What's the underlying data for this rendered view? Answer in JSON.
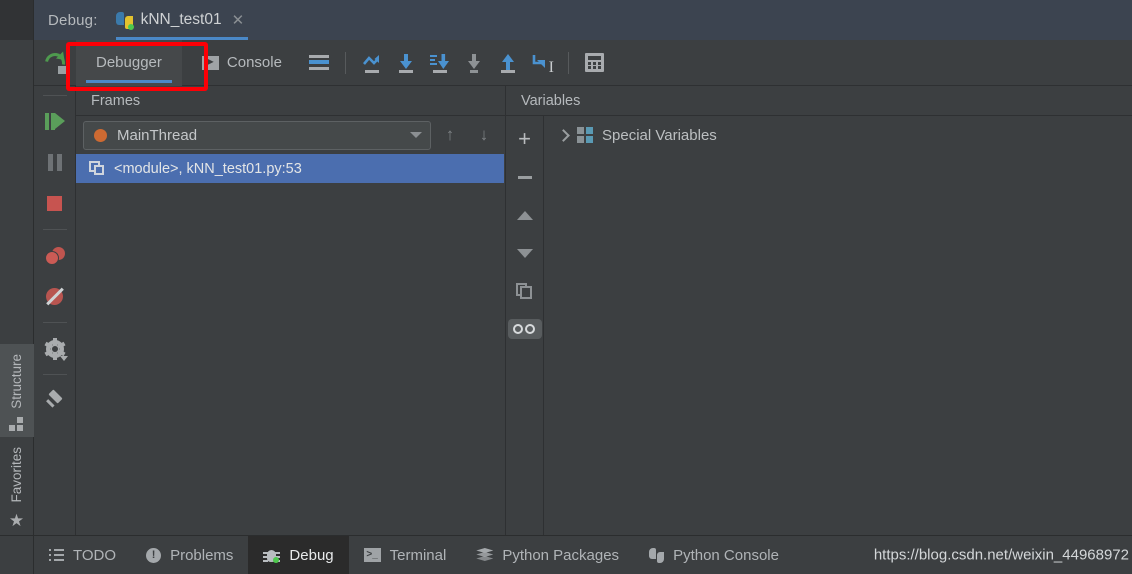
{
  "titlebar": {
    "debug_label": "Debug:",
    "run_config_name": "kNN_test01",
    "close_glyph": "✕",
    "python_icon": "python-logo-icon"
  },
  "tabs": {
    "rerun_icon": "rerun-icon",
    "items": [
      {
        "label": "Debugger",
        "icon": "debugger-icon",
        "selected": true
      },
      {
        "label": "Console",
        "icon": "console-icon",
        "selected": false
      }
    ]
  },
  "toolbar": {
    "buttons": [
      {
        "name": "show-execution-point-button",
        "icon": "lines-icon",
        "tooltip": "Show Execution Point"
      },
      {
        "name": "step-over-button",
        "icon": "step-over-icon",
        "tooltip": "Step Over"
      },
      {
        "name": "step-into-button",
        "icon": "step-into-icon",
        "tooltip": "Step Into"
      },
      {
        "name": "force-step-into-button",
        "icon": "force-step-into-icon",
        "tooltip": "Force Step Into"
      },
      {
        "name": "step-into-my-code-button",
        "icon": "step-into-my-code-icon",
        "tooltip": "Step Into My Code"
      },
      {
        "name": "step-out-button",
        "icon": "step-out-icon",
        "tooltip": "Step Out"
      },
      {
        "name": "run-to-cursor-button",
        "icon": "run-to-cursor-icon",
        "tooltip": "Run to Cursor"
      },
      {
        "name": "evaluate-expression-button",
        "icon": "calculator-icon",
        "tooltip": "Evaluate Expression"
      }
    ]
  },
  "run_gutter": {
    "buttons": [
      {
        "name": "resume-program-button",
        "icon": "resume-icon"
      },
      {
        "name": "pause-program-button",
        "icon": "pause-icon"
      },
      {
        "name": "stop-program-button",
        "icon": "stop-icon"
      },
      {
        "name": "view-breakpoints-button",
        "icon": "breakpoints-icon"
      },
      {
        "name": "mute-breakpoints-button",
        "icon": "mute-breakpoints-icon"
      },
      {
        "name": "settings-button",
        "icon": "gear-icon"
      },
      {
        "name": "pin-tab-button",
        "icon": "pin-icon"
      }
    ]
  },
  "left_strip": {
    "tabs": [
      {
        "label": "Structure",
        "icon": "structure-icon",
        "active": true
      },
      {
        "label": "Favorites",
        "icon": "star-icon",
        "active": false
      }
    ]
  },
  "frames": {
    "header": "Frames",
    "thread": {
      "name": "MainThread",
      "status_color": "#cd6a32",
      "caret_icon": "chevron-down-icon"
    },
    "nav": {
      "up_glyph": "↑",
      "down_glyph": "↓"
    },
    "rows": [
      {
        "label": "<module>, kNN_test01.py:53",
        "icon": "frame-icon",
        "selected": true
      }
    ]
  },
  "variables": {
    "header": "Variables",
    "gutter_buttons": [
      {
        "name": "add-watch-button",
        "icon": "plus-icon",
        "glyph": "+",
        "toggled": false
      },
      {
        "name": "remove-watch-button",
        "icon": "minus-icon",
        "toggled": false
      },
      {
        "name": "move-watch-up-button",
        "icon": "arrow-up-icon",
        "toggled": false
      },
      {
        "name": "move-watch-down-button",
        "icon": "arrow-down-icon",
        "toggled": false
      },
      {
        "name": "copy-value-button",
        "icon": "copy-icon",
        "toggled": false
      },
      {
        "name": "inspect-watches-button",
        "icon": "glasses-icon",
        "toggled": true
      }
    ],
    "rows": [
      {
        "label": "Special Variables",
        "icon": "special-variables-icon",
        "expander": "chevron-right-icon",
        "expanded": false
      }
    ]
  },
  "statusbar": {
    "items": [
      {
        "label": "TODO",
        "icon": "todo-icon",
        "active": false
      },
      {
        "label": "Problems",
        "icon": "problems-icon",
        "active": false
      },
      {
        "label": "Debug",
        "icon": "bug-icon",
        "active": true
      },
      {
        "label": "Terminal",
        "icon": "terminal-icon",
        "active": false
      },
      {
        "label": "Python Packages",
        "icon": "packages-icon",
        "active": false
      },
      {
        "label": "Python Console",
        "icon": "python-console-icon",
        "active": false
      }
    ],
    "watermark": "https://blog.csdn.net/weixin_44968972"
  },
  "annotation": {
    "type": "red-rectangle-highlight",
    "target": "Debugger tab"
  },
  "colors": {
    "panel_bg": "#3c3f41",
    "titlebar_bg": "#3c4450",
    "selection_blue": "#4b6eaf",
    "accent_blue": "#4a88c7",
    "annotation_red": "#fd0006",
    "thread_orange": "#cd6a32",
    "run_green": "#5a9e5a",
    "stop_red": "#c75450"
  }
}
